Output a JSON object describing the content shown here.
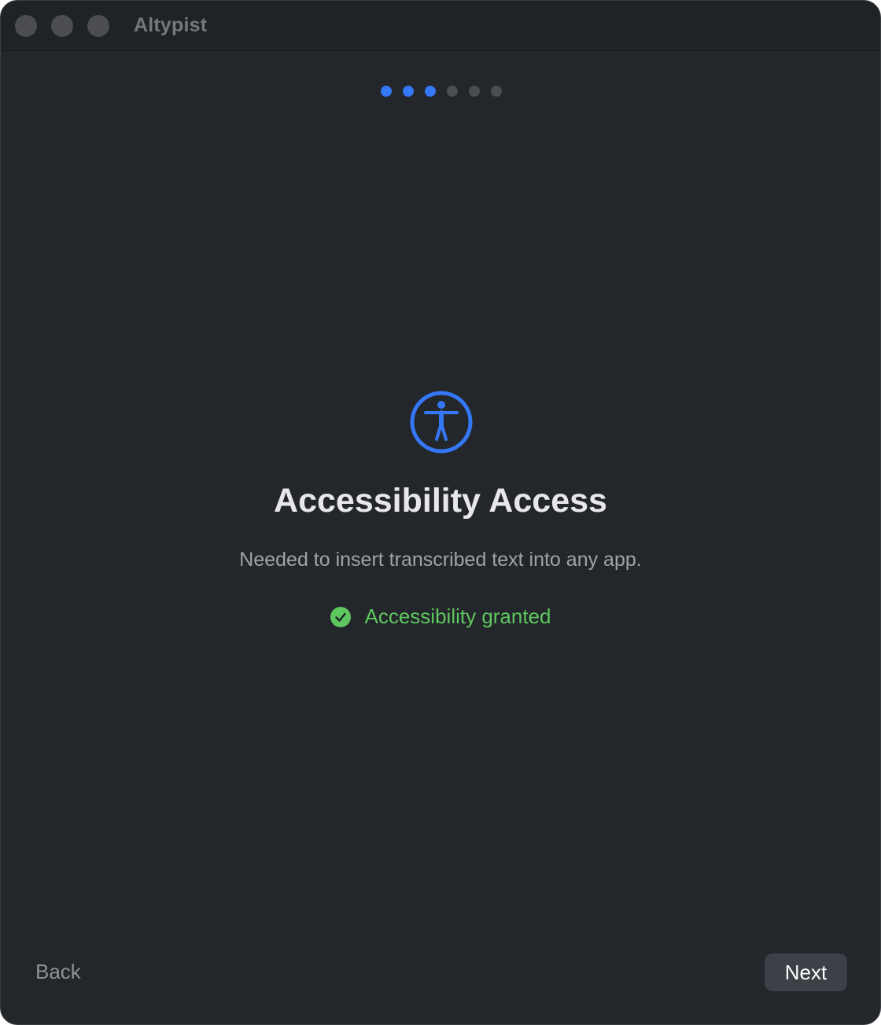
{
  "window": {
    "app_title": "Altypist"
  },
  "progress": {
    "total_steps": 6,
    "completed_steps": 3
  },
  "hero": {
    "icon": "accessibility-icon",
    "title": "Accessibility Access",
    "subtitle": "Needed to insert transcribed text into any app."
  },
  "status": {
    "icon": "checkmark-circle-icon",
    "text": "Accessibility granted"
  },
  "footer": {
    "back_label": "Back",
    "next_label": "Next"
  },
  "colors": {
    "accent": "#3478f6",
    "success": "#5ec75f",
    "background": "#23262b"
  }
}
